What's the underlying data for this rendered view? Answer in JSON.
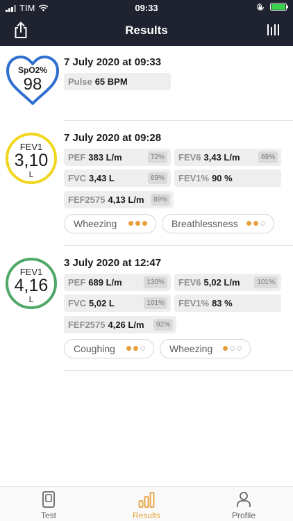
{
  "status_bar": {
    "carrier": "TIM",
    "time": "09:33"
  },
  "header": {
    "title": "Results"
  },
  "results": [
    {
      "kind": "spo2",
      "circle_label": "SpO2%",
      "circle_value": "98",
      "datetime": "7 July 2020 at 09:33",
      "metrics": [
        {
          "key": "Pulse",
          "value": "65 BPM"
        }
      ],
      "symptoms": []
    },
    {
      "kind": "fev1",
      "circle_label": "FEV1",
      "circle_value": "3,10",
      "circle_unit": "L",
      "datetime": "7 July 2020 at 09:28",
      "metrics": [
        {
          "key": "PEF",
          "value": "383 L/m",
          "pct": "72%"
        },
        {
          "key": "FEV6",
          "value": "3,43 L/m",
          "pct": "69%"
        },
        {
          "key": "FVC",
          "value": "3,43 L",
          "pct": "69%"
        },
        {
          "key": "FEV1%",
          "value": "90 %"
        },
        {
          "key": "FEF2575",
          "value": "4,13 L/m",
          "pct": "89%"
        }
      ],
      "symptoms": [
        {
          "label": "Wheezing",
          "level": 3
        },
        {
          "label": "Breathlessness",
          "level": 2
        }
      ]
    },
    {
      "kind": "fev1",
      "circle_label": "FEV1",
      "circle_value": "4,16",
      "circle_unit": "L",
      "datetime": "3 July 2020 at 12:47",
      "metrics": [
        {
          "key": "PEF",
          "value": "689 L/m",
          "pct": "130%"
        },
        {
          "key": "FEV6",
          "value": "5,02 L/m",
          "pct": "101%"
        },
        {
          "key": "FVC",
          "value": "5,02 L",
          "pct": "101%"
        },
        {
          "key": "FEV1%",
          "value": "83 %"
        },
        {
          "key": "FEF2575",
          "value": "4,26 L/m",
          "pct": "92%"
        }
      ],
      "symptoms": [
        {
          "label": "Coughing",
          "level": 2
        },
        {
          "label": "Wheezing",
          "level": 1
        }
      ]
    }
  ],
  "colors": {
    "header": "#1f2330",
    "spo2": "#2f6fd0",
    "warning": "#f1d61e",
    "ok": "#4fa866",
    "accent": "#e8a03b"
  },
  "tabs": [
    {
      "label": "Test",
      "icon": "device-icon",
      "active": false
    },
    {
      "label": "Results",
      "icon": "chart-bars-icon",
      "active": true
    },
    {
      "label": "Profile",
      "icon": "person-icon",
      "active": false
    }
  ]
}
